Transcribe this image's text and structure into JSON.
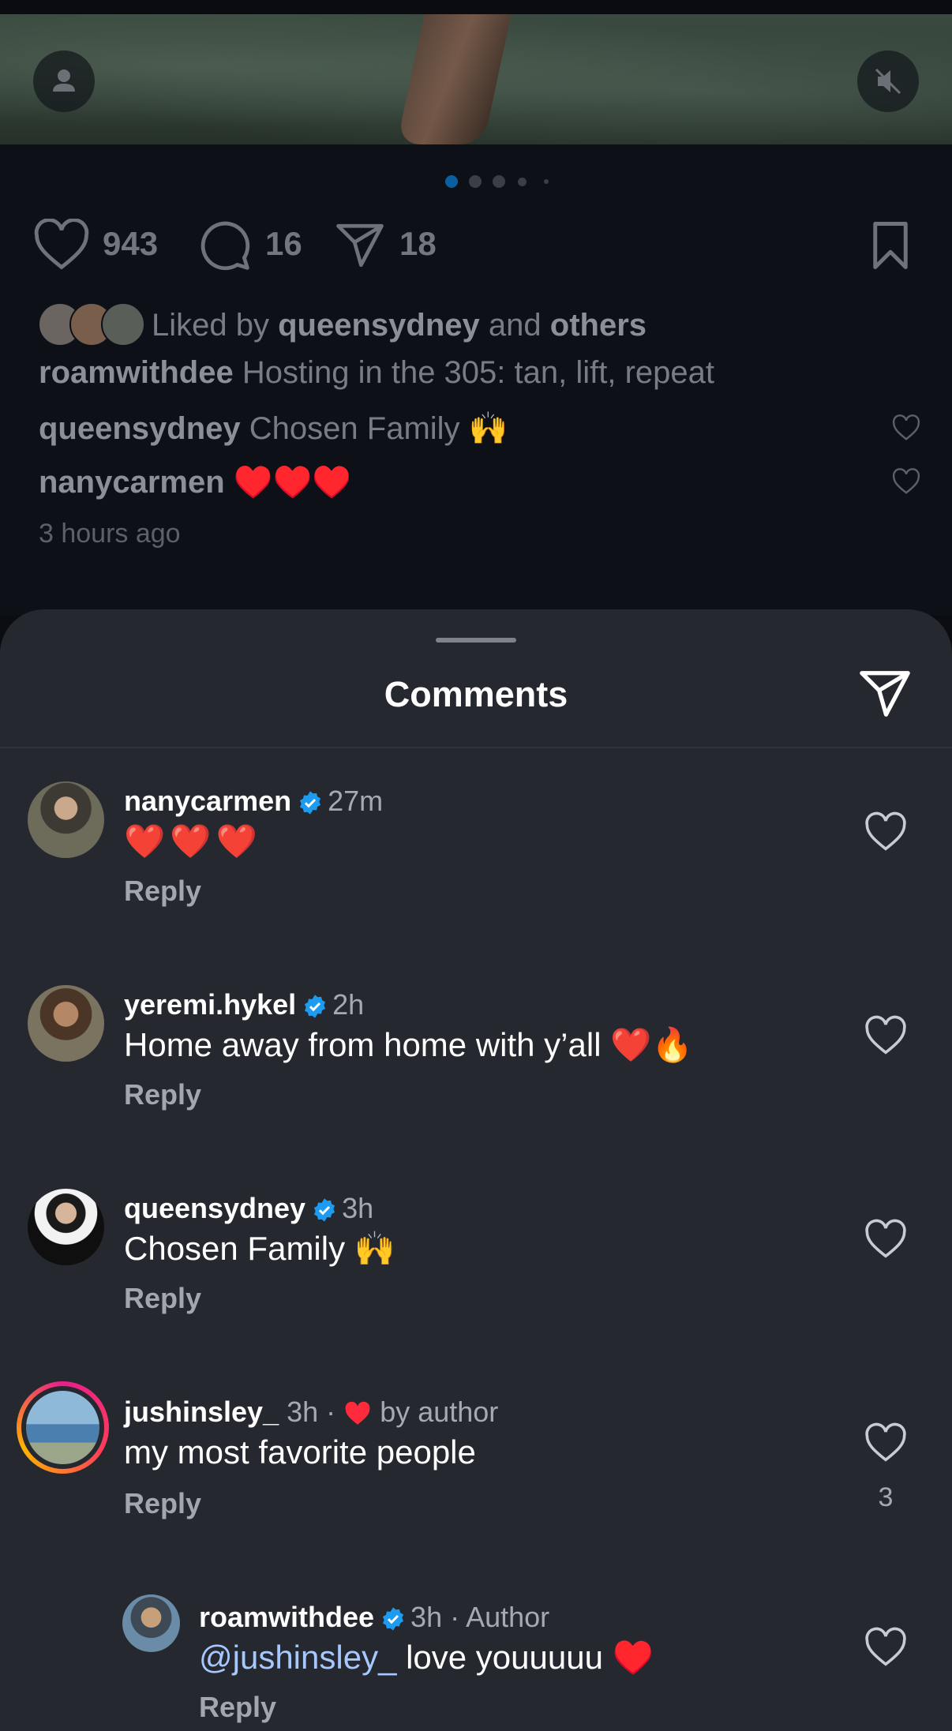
{
  "post": {
    "likes": "943",
    "comments": "16",
    "shares": "18",
    "liked_by": {
      "prefix": "Liked by",
      "user": "queensydney",
      "and": "and",
      "others": "others"
    },
    "caption": {
      "user": "roamwithdee",
      "text": "Hosting in the 305: tan, lift, repeat"
    },
    "preview_comments": [
      {
        "user": "queensydney",
        "text": "Chosen Family 🙌"
      },
      {
        "user": "nanycarmen",
        "text": "♥️♥️♥️"
      }
    ],
    "time": "3 hours ago"
  },
  "sheet": {
    "title": "Comments",
    "reply_label": "Reply",
    "comments": [
      {
        "user": "nanycarmen",
        "verified": true,
        "time": "27m",
        "text": "❤️❤️❤️",
        "likes": ""
      },
      {
        "user": "yeremi.hykel",
        "verified": true,
        "time": "2h",
        "text": "Home away from home with y’all ❤️🔥",
        "likes": ""
      },
      {
        "user": "queensydney",
        "verified": true,
        "time": "3h",
        "text": "Chosen Family 🙌",
        "likes": ""
      },
      {
        "user": "jushinsley_",
        "verified": false,
        "time": "3h ·",
        "author_like": "by author",
        "text": "my most favorite people",
        "likes": "3"
      },
      {
        "user": "roamwithdee",
        "verified": true,
        "time": "3h · Author",
        "mention": "@jushinsley_",
        "text": " love youuuuu ♥️",
        "likes": ""
      }
    ]
  },
  "colors": {
    "accent": "#0095f6",
    "verified": "#1d9bf0",
    "like_red": "#ff2a3b",
    "sheet_bg": "#25282f"
  }
}
